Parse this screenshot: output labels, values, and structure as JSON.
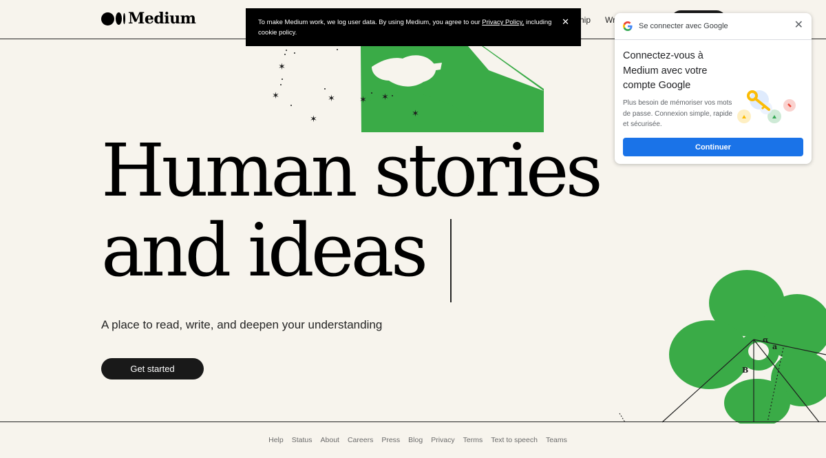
{
  "header": {
    "logo_text": "Medium",
    "nav": [
      "hip",
      "Wr"
    ]
  },
  "cookie_banner": {
    "text_before": "To make Medium work, we log user data. By using Medium, you agree to our ",
    "link": "Privacy Policy,",
    "text_after": " including cookie policy.",
    "close_icon": "close-icon"
  },
  "hero": {
    "title_line1": "Human stories",
    "title_line2": "and ideas",
    "subtitle": "A place to read, write, and deepen your understanding",
    "cta": "Get started"
  },
  "footer": {
    "links": [
      "Help",
      "Status",
      "About",
      "Careers",
      "Press",
      "Blog",
      "Privacy",
      "Terms",
      "Text to speech",
      "Teams"
    ]
  },
  "google_popup": {
    "header": "Se connecter avec Google",
    "title": "Connectez-vous à Medium avec votre compte Google",
    "description": "Plus besoin de mémoriser vos mots de passe. Connexion simple, rapide et sécurisée.",
    "button": "Continuer",
    "colors": {
      "blue": "#1a73e8",
      "red": "#ea4335",
      "yellow": "#fbbc05",
      "green": "#34a853"
    }
  },
  "colors": {
    "background": "#f7f4ed",
    "accent_green": "#3aab47",
    "text": "#242424"
  }
}
